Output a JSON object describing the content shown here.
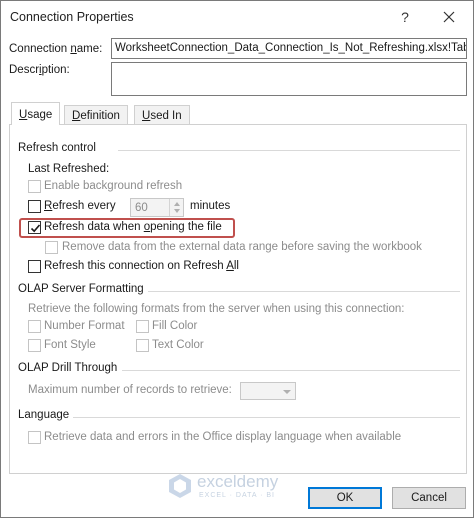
{
  "window": {
    "title": "Connection Properties",
    "help_glyph": "?",
    "close_icon": "close-icon"
  },
  "connection_name": {
    "label_pre": "Connection ",
    "label_u": "n",
    "label_post": "ame:",
    "value": "WorksheetConnection_Data_Connection_Is_Not_Refreshing.xlsx!Tab"
  },
  "description": {
    "label_pre": "Descr",
    "label_u": "i",
    "label_post": "ption:",
    "value": ""
  },
  "tabs": [
    {
      "pre": "",
      "u": "U",
      "post": "sage",
      "active": true
    },
    {
      "pre": "",
      "u": "D",
      "post": "efinition",
      "active": false
    },
    {
      "pre": "",
      "u": "U",
      "post": "sed In",
      "active": false
    }
  ],
  "refresh_control": {
    "header": "Refresh control",
    "last_refreshed": "Last Refreshed:",
    "background_refresh": {
      "label": "Enable background refresh",
      "checked": false,
      "enabled": false
    },
    "refresh_every": {
      "pre": "",
      "u": "R",
      "post": "efresh every",
      "value": "60",
      "unit": "minutes",
      "checked": false,
      "enabled": true
    },
    "refresh_on_open": {
      "pre": "Refresh data when ",
      "u": "o",
      "post": "pening the file",
      "checked": true,
      "enabled": true
    },
    "remove_data": {
      "label": "Remove data from the external data range before saving the workbook",
      "checked": false,
      "enabled": false
    },
    "refresh_all": {
      "pre": "Refresh this connection on Refresh ",
      "u": "A",
      "post": "ll",
      "checked": false,
      "enabled": true
    }
  },
  "olap_formatting": {
    "header": "OLAP Server Formatting",
    "intro": "Retrieve the following formats from the server when using this connection:",
    "number_format": "Number Format",
    "fill_color": "Fill Color",
    "font_style": "Font Style",
    "text_color": "Text Color"
  },
  "olap_drill": {
    "header": "OLAP Drill Through",
    "max_records": "Maximum number of records to retrieve:",
    "max_value": ""
  },
  "language": {
    "header": "Language",
    "retrieve_label": "Retrieve data and errors in the Office display language when available"
  },
  "buttons": {
    "ok": "OK",
    "cancel": "Cancel"
  },
  "watermark": {
    "name": "exceldemy",
    "tagline": "EXCEL · DATA · BI"
  },
  "colors": {
    "highlight": "#c0504d",
    "ok_border": "#0078d7"
  }
}
